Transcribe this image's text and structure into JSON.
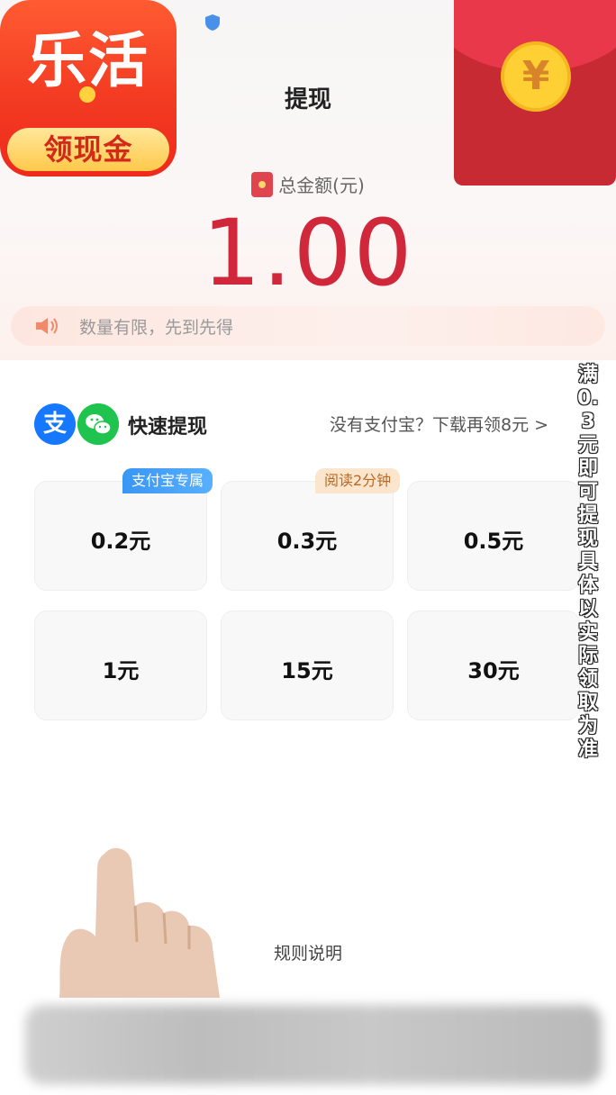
{
  "app_logo": {
    "title": "乐活",
    "banner": "领现金"
  },
  "envelope": {
    "symbol": "¥"
  },
  "header": {
    "title": "提现"
  },
  "balance": {
    "label": "总金额(元)",
    "amount": "1.00"
  },
  "notice": {
    "text": "数量有限，先到先得"
  },
  "quick_withdraw": {
    "alipay_glyph": "支",
    "title": "快速提现",
    "download_link": "没有支付宝？下载再领8元 >"
  },
  "cards": [
    {
      "label": "0.2元",
      "tag": "支付宝专属"
    },
    {
      "label": "0.3元",
      "tag": "阅读2分钟"
    },
    {
      "label": "0.5元"
    },
    {
      "label": "1元"
    },
    {
      "label": "15元"
    },
    {
      "label": "30元"
    }
  ],
  "caption": "满0.3元即可提现具体以实际领取为准",
  "footer": {
    "rules_label": "规则说明"
  },
  "colors": {
    "accent_red": "#d0283a",
    "alipay_blue": "#1677ff",
    "wechat_green": "#1fc44f"
  }
}
